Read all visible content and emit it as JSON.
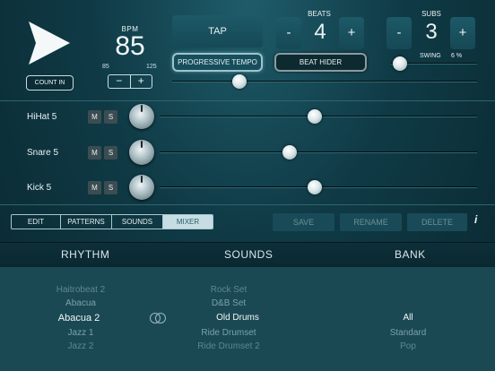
{
  "transport": {
    "count_in_label": "COUNT IN",
    "bpm_label": "BPM",
    "bpm_value": "85",
    "bpm_min": "85",
    "bpm_max": "125",
    "bpm_decrement": "−",
    "bpm_increment": "+",
    "tap_label": "TAP",
    "progressive_tempo_label": "PROGRESSIVE TEMPO",
    "beat_hider_label": "BEAT HIDER",
    "beats_label": "BEATS",
    "beats_value": "4",
    "subs_label": "SUBS",
    "subs_value": "3",
    "swing_label": "SWING",
    "swing_value": "6 %",
    "minus": "-",
    "plus": "+",
    "tempo_slider_level": 0.22,
    "swing_slider_level": 0.1
  },
  "channels": [
    {
      "label": "HiHat 5",
      "mute": "M",
      "solo": "S",
      "level": 0.49
    },
    {
      "label": "Snare 5",
      "mute": "M",
      "solo": "S",
      "level": 0.41
    },
    {
      "label": "Kick 5",
      "mute": "M",
      "solo": "S",
      "level": 0.49
    }
  ],
  "tabs": [
    {
      "label": "EDIT",
      "active": false
    },
    {
      "label": "PATTERNS",
      "active": false
    },
    {
      "label": "SOUNDS",
      "active": false
    },
    {
      "label": "MIXER",
      "active": true
    }
  ],
  "actions": {
    "save": "SAVE",
    "rename": "RENAME",
    "delete": "DELETE",
    "info": "i"
  },
  "picker": {
    "headers": {
      "rhythm": "RHYTHM",
      "sounds": "SOUNDS",
      "bank": "BANK"
    },
    "rhythm": [
      "Haitrobeat 2",
      "Abacua",
      "Abacua 2",
      "Jazz 1",
      "Jazz 2"
    ],
    "sounds": [
      "Rock Set",
      "D&B Set",
      "Old Drums",
      "Ride Drumset",
      "Ride Drumset 2"
    ],
    "bank": [
      "All",
      "Standard",
      "Pop"
    ]
  },
  "icons": {
    "play": "play-icon",
    "link": "link-icon",
    "knob": "pan-knob-icon"
  },
  "colors": {
    "background": "#0f3a45",
    "active_tab": "#c6dde3",
    "button_panel": "#1d5967"
  }
}
